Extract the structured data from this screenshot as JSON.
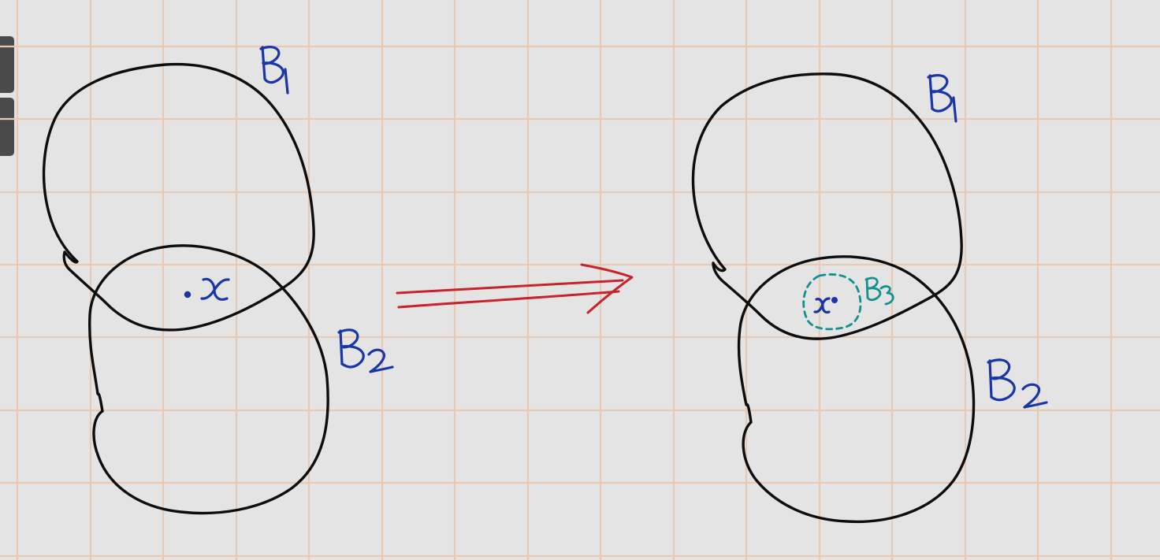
{
  "colors": {
    "paper": "#e4e4e4",
    "grid": "#e8c9b3",
    "ink_black": "#0d0d0d",
    "ink_blue": "#1a35a8",
    "ink_teal": "#129191",
    "ink_red": "#c8232c",
    "side_tab": "#4a4a4a"
  },
  "left_panel": {
    "ball_1_label": "B1",
    "ball_2_label": "B2",
    "point_label": "x"
  },
  "right_panel": {
    "ball_1_label": "B1",
    "ball_2_label": "B2",
    "ball_3_label": "B3",
    "point_label": "x"
  },
  "arrow": {
    "kind": "implies-double-arrow",
    "color_name": "red"
  },
  "toolbar": {
    "tabs": [
      "tool-tab-1",
      "tool-tab-2"
    ]
  }
}
